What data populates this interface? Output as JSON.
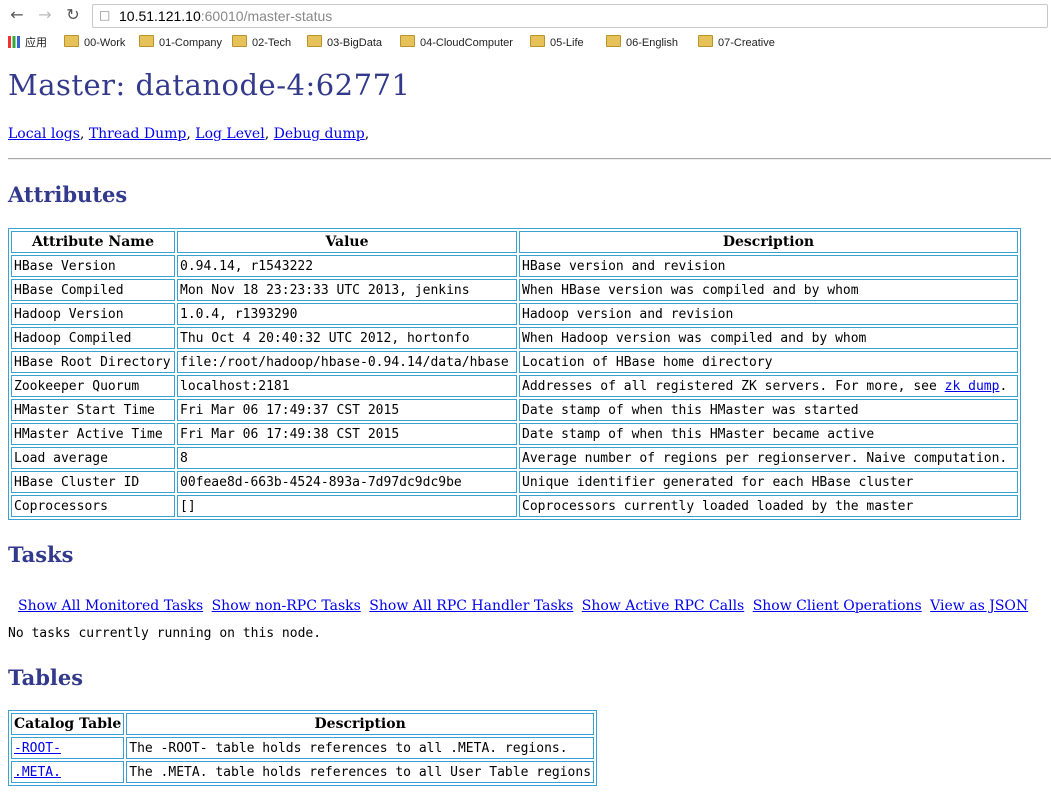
{
  "browser": {
    "url_host": "10.51.121.10",
    "url_rest": ":60010/master-status",
    "bookmarks": [
      {
        "label": "应用",
        "icon": "apps-icon"
      },
      {
        "label": "00-Work",
        "icon": "folder-icon"
      },
      {
        "label": "01-Company",
        "icon": "folder-icon"
      },
      {
        "label": "02-Tech",
        "icon": "folder-icon"
      },
      {
        "label": "03-BigData",
        "icon": "folder-icon"
      },
      {
        "label": "04-CloudComputer",
        "icon": "folder-icon"
      },
      {
        "label": "05-Life",
        "icon": "folder-icon"
      },
      {
        "label": "06-English",
        "icon": "folder-icon"
      },
      {
        "label": "07-Creative",
        "icon": "folder-icon"
      }
    ]
  },
  "page": {
    "title": "Master: datanode-4:62771",
    "links": [
      "Local logs",
      "Thread Dump",
      "Log Level",
      "Debug dump"
    ],
    "attributes_heading": "Attributes",
    "attributes_headers": [
      "Attribute Name",
      "Value",
      "Description"
    ],
    "attributes": [
      [
        "HBase Version",
        "0.94.14, r1543222",
        "HBase version and revision"
      ],
      [
        "HBase Compiled",
        "Mon Nov 18 23:23:33 UTC 2013, jenkins",
        "When HBase version was compiled and by whom"
      ],
      [
        "Hadoop Version",
        "1.0.4, r1393290",
        "Hadoop version and revision"
      ],
      [
        "Hadoop Compiled",
        "Thu Oct 4 20:40:32 UTC 2012, hortonfo",
        "When Hadoop version was compiled and by whom"
      ],
      [
        "HBase Root Directory",
        "file:/root/hadoop/hbase-0.94.14/data/hbase",
        "Location of HBase home directory"
      ],
      [
        "Zookeeper Quorum",
        "localhost:2181",
        "Addresses of all registered ZK servers. For more, see "
      ],
      [
        "HMaster Start Time",
        "Fri Mar 06 17:49:37 CST 2015",
        "Date stamp of when this HMaster was started"
      ],
      [
        "HMaster Active Time",
        "Fri Mar 06 17:49:38 CST 2015",
        "Date stamp of when this HMaster became active"
      ],
      [
        "Load average",
        "8",
        "Average number of regions per regionserver. Naive computation."
      ],
      [
        "HBase Cluster ID",
        "00feae8d-663b-4524-893a-7d97dc9dc9be",
        "Unique identifier generated for each HBase cluster"
      ],
      [
        "Coprocessors",
        "[]",
        "Coprocessors currently loaded loaded by the master"
      ]
    ],
    "zk_dump_link": "zk dump",
    "tasks_heading": "Tasks",
    "task_links": [
      "Show All Monitored Tasks",
      "Show non-RPC Tasks",
      "Show All RPC Handler Tasks",
      "Show Active RPC Calls",
      "Show Client Operations",
      "View as JSON"
    ],
    "no_tasks": "No tasks currently running on this node.",
    "tables_heading": "Tables",
    "tables_headers": [
      "Catalog Table",
      "Description"
    ],
    "tables": [
      [
        "-ROOT-",
        "The -ROOT- table holds references to all .META. regions."
      ],
      [
        ".META.",
        "The .META. table holds references to all User Table regions"
      ]
    ]
  }
}
